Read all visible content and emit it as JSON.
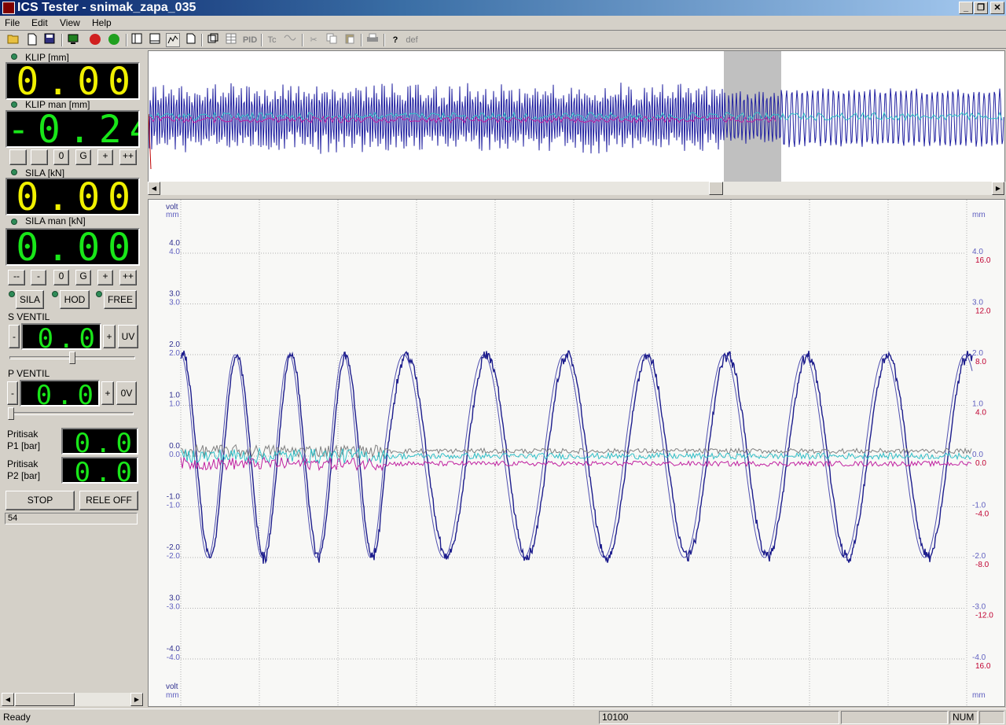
{
  "window": {
    "title": "ICS Tester - snimak_zapa_035",
    "minimize": "_",
    "maximize": "❐",
    "close": "✕"
  },
  "menu": [
    "File",
    "Edit",
    "View",
    "Help"
  ],
  "toolbar": {
    "pid_label": "PID",
    "tc_label": "Tc",
    "def_label": "def"
  },
  "klip": {
    "label": "KLIP [mm]",
    "value": "0.00"
  },
  "klip_man": {
    "label": "KLIP  man [mm]",
    "value": "-0.24",
    "buttons": [
      "",
      "",
      "0",
      "G",
      "+",
      "++"
    ]
  },
  "sila": {
    "label": "SILA [kN]",
    "value": "0.00"
  },
  "sila_man": {
    "label": "SILA man [kN]",
    "value": "0.00",
    "buttons": [
      "--",
      "-",
      "0",
      "G",
      "+",
      "++"
    ]
  },
  "modes": [
    "SILA",
    "HOD",
    "FREE"
  ],
  "s_ventil": {
    "label": "S VENTIL",
    "value": "0.0",
    "minus": "-",
    "plus": "+",
    "extra": "UV",
    "slider_fraction": 0.5
  },
  "p_ventil": {
    "label": "P VENTIL",
    "value": "0.0",
    "minus": "-",
    "plus": "+",
    "extra": "0V",
    "slider_fraction": 0.0
  },
  "pritisak1": {
    "label1": "Pritisak",
    "label2": "P1 [bar]",
    "value": "0.0"
  },
  "pritisak2": {
    "label1": "Pritisak",
    "label2": "P2 [bar]",
    "value": "0.0"
  },
  "actions": {
    "stop": "STOP",
    "rele": "RELE OFF"
  },
  "counter_value": "54",
  "status": {
    "ready": "Ready",
    "position": "10100",
    "num": "NUM"
  },
  "chart_data": {
    "type": "line",
    "left_axis_units": [
      "volt",
      "mm"
    ],
    "right_axis_units": [
      "mm"
    ],
    "left_ticks_volt": [
      "4.0",
      "3.0",
      "2.0",
      "1.0",
      "0.0",
      "-1.0",
      "-2.0",
      "3.0",
      "-4.0"
    ],
    "left_ticks_mm": [
      "4.0",
      "3.0",
      "2.0",
      "1.0",
      "0.0",
      "-1.0",
      "-2.0",
      "-3.0",
      "-4.0"
    ],
    "right_ticks_mm": [
      "4.0",
      "3.0",
      "2.0",
      "1.0",
      "0.0",
      "-1.0",
      "-2.0",
      "-3.0",
      "-4.0"
    ],
    "right_ticks_force": [
      "16.0",
      "12.0",
      "8.0",
      "4.0",
      "0.0",
      "-4.0",
      "-8.0",
      "-12.0",
      "16.0"
    ],
    "ylim": [
      -5,
      5
    ],
    "grid": true,
    "series": [
      {
        "color": "#1c1c8c",
        "amplitude": 2.0,
        "kind": "sine-measured"
      },
      {
        "color": "#5050b0",
        "amplitude": 2.0,
        "kind": "sine-reference"
      },
      {
        "color": "#808080",
        "amplitude": 0.05,
        "offset": 0.1,
        "kind": "noise"
      },
      {
        "color": "#30c0c8",
        "amplitude": 0.06,
        "offset": 0.0,
        "kind": "noise"
      },
      {
        "color": "#c020a0",
        "amplitude": 0.05,
        "offset": -0.15,
        "kind": "noise"
      }
    ],
    "frequency_change": "high frequency in first third, lower frequency afterwards"
  },
  "overview": {
    "selection_label": "visible window"
  }
}
